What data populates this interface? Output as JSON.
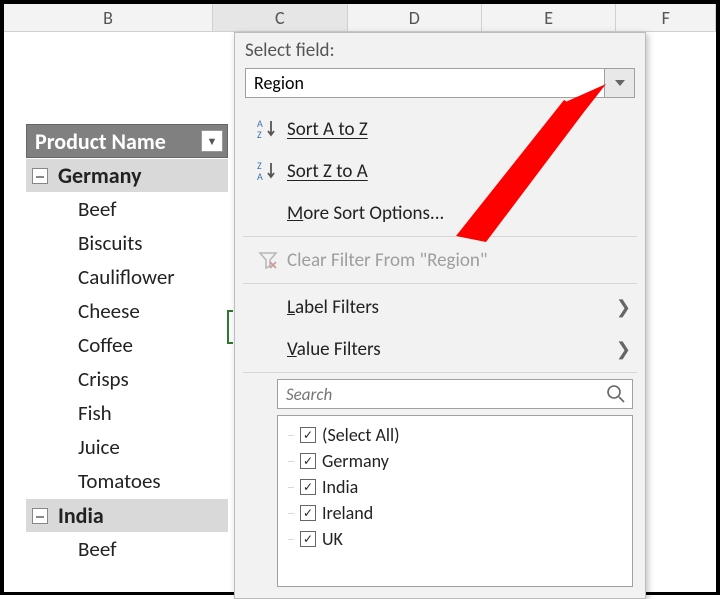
{
  "columns": {
    "B": "B",
    "C": "C",
    "D": "D",
    "E": "E",
    "F": "F"
  },
  "pivot": {
    "header": "Product Name",
    "groups": [
      {
        "name": "Germany",
        "items": [
          "Beef",
          "Biscuits",
          "Cauliflower",
          "Cheese",
          "Coffee",
          "Crisps",
          "Fish",
          "Juice",
          "Tomatoes"
        ]
      },
      {
        "name": "India",
        "items": [
          "Beef"
        ]
      }
    ]
  },
  "menu": {
    "title": "Select field:",
    "selected_field": "Region",
    "sort_az": "Sort A to Z",
    "sort_za": "Sort Z to A",
    "more_sort": "More Sort Options...",
    "clear_filter": "Clear Filter From \"Region\"",
    "label_filters": "Label Filters",
    "value_filters": "Value Filters",
    "search_placeholder": "Search",
    "options": [
      "(Select All)",
      "Germany",
      "India",
      "Ireland",
      "UK"
    ]
  }
}
